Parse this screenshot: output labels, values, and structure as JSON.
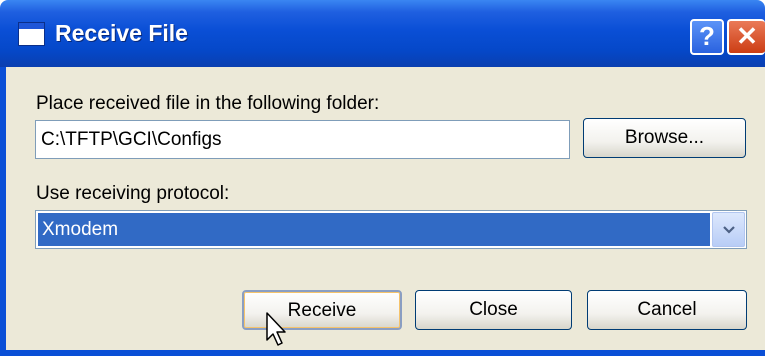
{
  "window": {
    "title": "Receive File",
    "icons": {
      "app": "window-icon",
      "help": "help-icon",
      "close": "close-icon"
    },
    "help_glyph": "?",
    "close_glyph": "✕"
  },
  "folder": {
    "label": "Place received file in the following folder:",
    "value": "C:\\TFTP\\GCI\\Configs",
    "browse_label": "Browse..."
  },
  "protocol": {
    "label": "Use receiving protocol:",
    "selected": "Xmodem",
    "arrow_icon": "chevron-down-icon"
  },
  "buttons": {
    "receive": "Receive",
    "close": "Close",
    "cancel": "Cancel"
  },
  "colors": {
    "titlebar": "#0a4fd6",
    "dialog_bg": "#ece9d8",
    "selection": "#316ac5",
    "close_button": "#cc3d14"
  },
  "cursor_icon": "mouse-pointer-icon"
}
